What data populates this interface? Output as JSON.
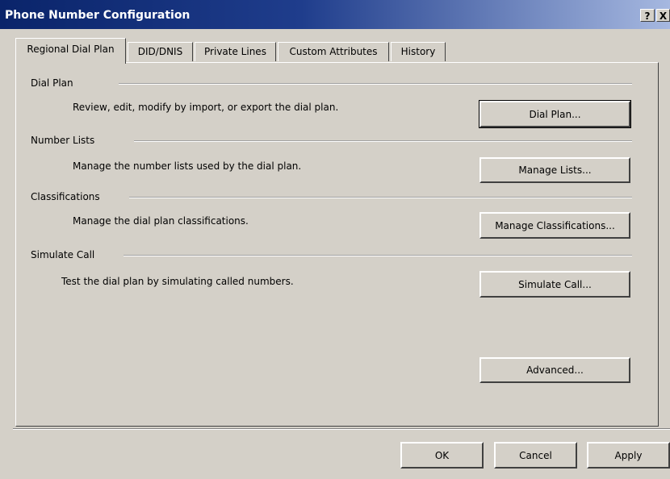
{
  "window": {
    "title": "Phone Number Configuration",
    "help_label": "?",
    "close_label": "X"
  },
  "tabs": [
    {
      "label": "Regional Dial Plan",
      "active": true
    },
    {
      "label": "DID/DNIS",
      "active": false
    },
    {
      "label": "Private Lines",
      "active": false
    },
    {
      "label": "Custom Attributes",
      "active": false
    },
    {
      "label": "History",
      "active": false
    }
  ],
  "sections": [
    {
      "title": "Dial Plan",
      "description": "Review, edit, modify by import, or export the dial plan.",
      "button": "Dial Plan..."
    },
    {
      "title": "Number Lists",
      "description": "Manage the number lists used by the dial plan.",
      "button": "Manage Lists..."
    },
    {
      "title": "Classifications",
      "description": "Manage the dial plan classifications.",
      "button": "Manage Classifications..."
    },
    {
      "title": "Simulate Call",
      "description": "Test the dial plan by simulating called numbers.",
      "button": "Simulate Call..."
    }
  ],
  "advanced_button": "Advanced...",
  "footer": {
    "ok": "OK",
    "cancel": "Cancel",
    "apply": "Apply"
  }
}
